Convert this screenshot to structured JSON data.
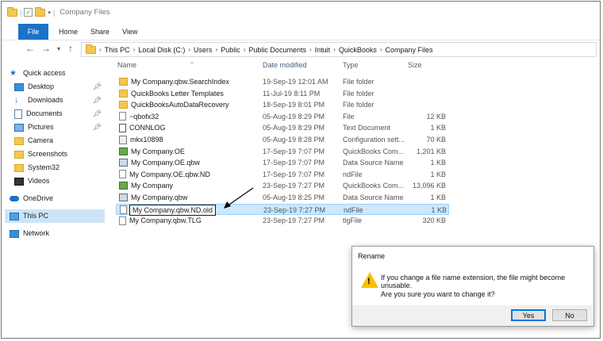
{
  "window": {
    "title": "Company Files"
  },
  "ribbon": {
    "tabs": [
      "File",
      "Home",
      "Share",
      "View"
    ]
  },
  "address": {
    "segments": [
      "This PC",
      "Local Disk (C:)",
      "Users",
      "Public",
      "Public Documents",
      "Intuit",
      "QuickBooks",
      "Company Files"
    ]
  },
  "sidebar": {
    "items": [
      {
        "label": "Quick access",
        "icon": "star-icon",
        "pinned": false
      },
      {
        "label": "Desktop",
        "icon": "desktop-icon",
        "pinned": true
      },
      {
        "label": "Downloads",
        "icon": "download-icon",
        "pinned": true
      },
      {
        "label": "Documents",
        "icon": "documents-icon",
        "pinned": true
      },
      {
        "label": "Pictures",
        "icon": "pictures-icon",
        "pinned": true
      },
      {
        "label": "Camera",
        "icon": "folder-icon",
        "pinned": false
      },
      {
        "label": "Screenshots",
        "icon": "folder-icon",
        "pinned": false
      },
      {
        "label": "System32",
        "icon": "folder-icon",
        "pinned": false
      },
      {
        "label": "Videos",
        "icon": "videos-icon",
        "pinned": false
      },
      {
        "label": "OneDrive",
        "icon": "onedrive-icon",
        "pinned": false
      },
      {
        "label": "This PC",
        "icon": "this-pc-icon",
        "pinned": false,
        "selected": true
      },
      {
        "label": "Network",
        "icon": "network-icon",
        "pinned": false
      }
    ]
  },
  "columns": {
    "name": "Name",
    "date": "Date modified",
    "type": "Type",
    "size": "Size"
  },
  "files": [
    {
      "name": "My Company.qbw.SearchIndex",
      "date": "19-Sep-19 12:01 AM",
      "type": "File folder",
      "size": "",
      "icon": "folder"
    },
    {
      "name": "QuickBooks Letter Templates",
      "date": "11-Jul-19 8:11 PM",
      "type": "File folder",
      "size": "",
      "icon": "folder"
    },
    {
      "name": "QuickBooksAutoDataRecovery",
      "date": "18-Sep-19 8:01 PM",
      "type": "File folder",
      "size": "",
      "icon": "folder"
    },
    {
      "name": "~qbofx32",
      "date": "05-Aug-19 8:29 PM",
      "type": "File",
      "size": "12 KB",
      "icon": "file"
    },
    {
      "name": "CONNLOG",
      "date": "05-Aug-19 8:29 PM",
      "type": "Text Document",
      "size": "1 KB",
      "icon": "text"
    },
    {
      "name": "mkx10898",
      "date": "05-Aug-19 8:28 PM",
      "type": "Configuration sett...",
      "size": "70 KB",
      "icon": "cfg"
    },
    {
      "name": "My Company.OE",
      "date": "17-Sep-19 7:07 PM",
      "type": "QuickBooks Com...",
      "size": "1,201 KB",
      "icon": "qb"
    },
    {
      "name": "My Company.OE.qbw",
      "date": "17-Sep-19 7:07 PM",
      "type": "Data Source Name",
      "size": "1 KB",
      "icon": "ds"
    },
    {
      "name": "My Company.OE.qbw.ND",
      "date": "17-Sep-19 7:07 PM",
      "type": "ndFile",
      "size": "1 KB",
      "icon": "file"
    },
    {
      "name": "My Company",
      "date": "23-Sep-19 7:27 PM",
      "type": "QuickBooks Com...",
      "size": "13,096 KB",
      "icon": "qb"
    },
    {
      "name": "My Company.qbw",
      "date": "05-Aug-19 8:25 PM",
      "type": "Data Source Name",
      "size": "1 KB",
      "icon": "ds"
    },
    {
      "name": "My Company.qbw.ND.old",
      "date": "23-Sep-19 7:27 PM",
      "type": "ndFile",
      "size": "1 KB",
      "icon": "file",
      "selected": true,
      "renaming": true
    },
    {
      "name": "My Company.qbw.TLG",
      "date": "23-Sep-19 7:27 PM",
      "type": "tlgFile",
      "size": "320 KB",
      "icon": "file"
    }
  ],
  "dialog": {
    "title": "Rename",
    "message": "If you change a file name extension, the file might become unusable.",
    "question": "Are you sure you want to change it?",
    "yes_label": "Yes",
    "no_label": "No"
  }
}
